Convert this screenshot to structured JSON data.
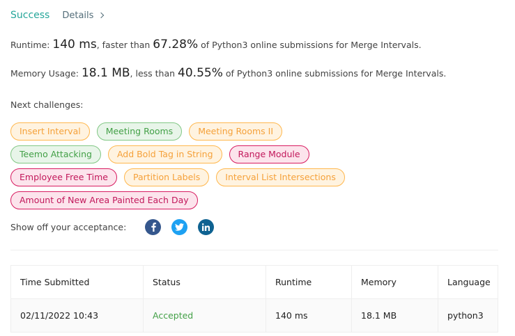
{
  "header": {
    "status": "Success",
    "details_label": "Details"
  },
  "runtime": {
    "prefix": "Runtime: ",
    "value": "140 ms",
    "mid": ", faster than ",
    "percent": "67.28%",
    "suffix": " of Python3 online submissions for Merge Intervals."
  },
  "memory": {
    "prefix": "Memory Usage: ",
    "value": "18.1 MB",
    "mid": ", less than ",
    "percent": "40.55%",
    "suffix": " of Python3 online submissions for Merge Intervals."
  },
  "next_challenges": {
    "label": "Next challenges:",
    "rows": [
      [
        {
          "name": "Insert Interval",
          "difficulty": "medium"
        },
        {
          "name": "Meeting Rooms",
          "difficulty": "easy"
        },
        {
          "name": "Meeting Rooms II",
          "difficulty": "medium"
        }
      ],
      [
        {
          "name": "Teemo Attacking",
          "difficulty": "easy"
        },
        {
          "name": "Add Bold Tag in String",
          "difficulty": "medium"
        },
        {
          "name": "Range Module",
          "difficulty": "hard"
        }
      ],
      [
        {
          "name": "Employee Free Time",
          "difficulty": "hard"
        },
        {
          "name": "Partition Labels",
          "difficulty": "medium"
        },
        {
          "name": "Interval List Intersections",
          "difficulty": "medium"
        }
      ],
      [
        {
          "name": "Amount of New Area Painted Each Day",
          "difficulty": "hard"
        }
      ]
    ]
  },
  "share": {
    "label": "Show off your acceptance:",
    "icons": [
      "facebook-icon",
      "twitter-icon",
      "linkedin-icon"
    ]
  },
  "table": {
    "headers": [
      "Time Submitted",
      "Status",
      "Runtime",
      "Memory",
      "Language"
    ],
    "rows": [
      [
        "02/11/2022 10:43",
        "Accepted",
        "140 ms",
        "18.1 MB",
        "python3"
      ]
    ]
  },
  "colors": {
    "success": "#26a69a",
    "accepted": "#43a047",
    "easy": "#43a047",
    "medium": "#f5a13a",
    "hard": "#c2185b"
  }
}
